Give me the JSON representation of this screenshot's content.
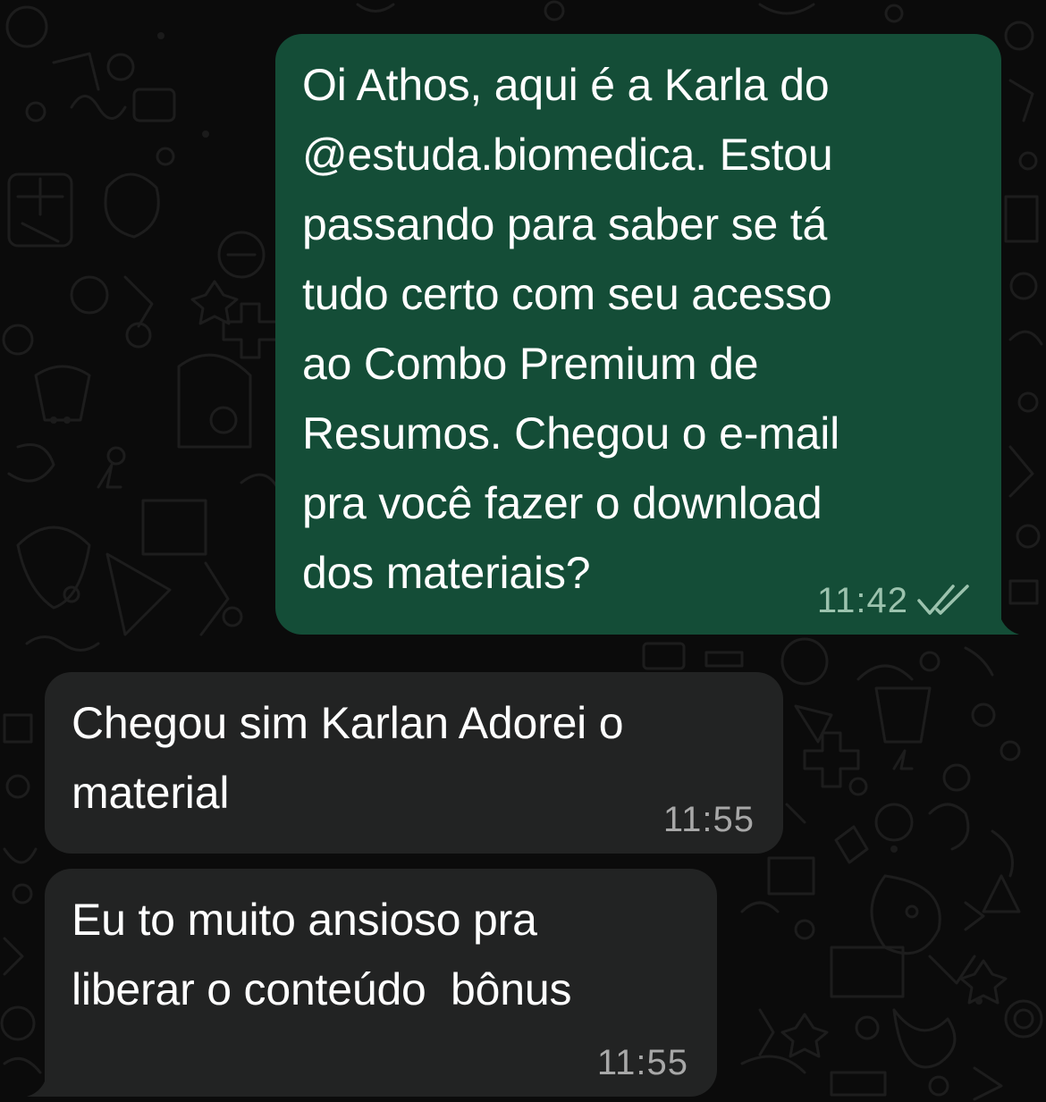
{
  "messages": [
    {
      "direction": "outgoing",
      "text": "Oi Athos, aqui é a Karla do\n@estuda.biomedica. Estou\npassando para saber se tá\ntudo certo com seu acesso\nao Combo Premium de\nResumos. Chegou o e-mail\npra você fazer o download\ndos materiais?",
      "time": "11:42",
      "status_icon": "double-check-icon"
    },
    {
      "direction": "incoming",
      "text": "Chegou sim Karlan Adorei o\nmaterial",
      "time": "11:55"
    },
    {
      "direction": "incoming",
      "text": "Eu to muito ansioso pra\nliberar o conteúdo  bônus",
      "time": "11:55"
    }
  ],
  "colors": {
    "background": "#0b0b0b",
    "outgoing_bubble": "#144d37",
    "incoming_bubble": "#222323",
    "text": "#ffffff",
    "outgoing_time": "#9cc3ae",
    "incoming_time": "#a8a8a8",
    "doodle": "#1b1b1b"
  },
  "background_pattern": "whatsapp-doodle-pattern"
}
